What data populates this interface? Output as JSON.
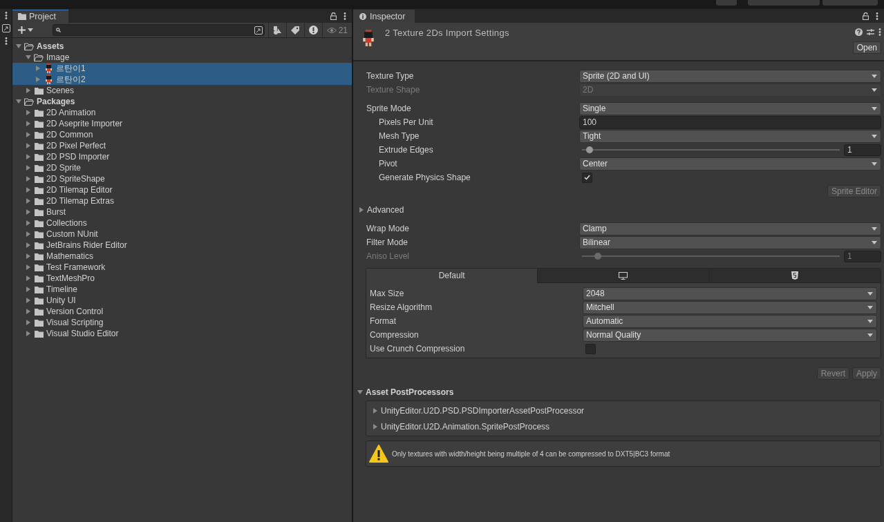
{
  "project": {
    "tab": "Project",
    "hidden_count": "21",
    "tree": [
      {
        "label": "Assets",
        "kind": "folder",
        "expanded": true,
        "selected": false,
        "children": [
          {
            "label": "Image",
            "kind": "folder",
            "expanded": true,
            "selected": false,
            "children": [
              {
                "label": "르탄이1",
                "kind": "sprite",
                "expanded": false,
                "selected": true
              },
              {
                "label": "르탄이2",
                "kind": "sprite",
                "expanded": false,
                "selected": true
              }
            ]
          },
          {
            "label": "Scenes",
            "kind": "folder",
            "expanded": false,
            "selected": false
          }
        ]
      },
      {
        "label": "Packages",
        "kind": "folder",
        "expanded": true,
        "selected": false,
        "children": [
          {
            "label": "2D Animation",
            "kind": "folder",
            "expanded": false,
            "selected": false
          },
          {
            "label": "2D Aseprite Importer",
            "kind": "folder",
            "expanded": false,
            "selected": false
          },
          {
            "label": "2D Common",
            "kind": "folder",
            "expanded": false,
            "selected": false
          },
          {
            "label": "2D Pixel Perfect",
            "kind": "folder",
            "expanded": false,
            "selected": false
          },
          {
            "label": "2D PSD Importer",
            "kind": "folder",
            "expanded": false,
            "selected": false
          },
          {
            "label": "2D Sprite",
            "kind": "folder",
            "expanded": false,
            "selected": false
          },
          {
            "label": "2D SpriteShape",
            "kind": "folder",
            "expanded": false,
            "selected": false
          },
          {
            "label": "2D Tilemap Editor",
            "kind": "folder",
            "expanded": false,
            "selected": false
          },
          {
            "label": "2D Tilemap Extras",
            "kind": "folder",
            "expanded": false,
            "selected": false
          },
          {
            "label": "Burst",
            "kind": "folder",
            "expanded": false,
            "selected": false
          },
          {
            "label": "Collections",
            "kind": "folder",
            "expanded": false,
            "selected": false
          },
          {
            "label": "Custom NUnit",
            "kind": "folder",
            "expanded": false,
            "selected": false
          },
          {
            "label": "JetBrains Rider Editor",
            "kind": "folder",
            "expanded": false,
            "selected": false
          },
          {
            "label": "Mathematics",
            "kind": "folder",
            "expanded": false,
            "selected": false
          },
          {
            "label": "Test Framework",
            "kind": "folder",
            "expanded": false,
            "selected": false
          },
          {
            "label": "TextMeshPro",
            "kind": "folder",
            "expanded": false,
            "selected": false
          },
          {
            "label": "Timeline",
            "kind": "folder",
            "expanded": false,
            "selected": false
          },
          {
            "label": "Unity UI",
            "kind": "folder",
            "expanded": false,
            "selected": false
          },
          {
            "label": "Version Control",
            "kind": "folder",
            "expanded": false,
            "selected": false
          },
          {
            "label": "Visual Scripting",
            "kind": "folder",
            "expanded": false,
            "selected": false
          },
          {
            "label": "Visual Studio Editor",
            "kind": "folder",
            "expanded": false,
            "selected": false
          }
        ]
      }
    ]
  },
  "inspector": {
    "tab": "Inspector",
    "title": "2 Texture 2Ds Import Settings",
    "open_button": "Open",
    "sections": [
      {
        "fields": [
          {
            "kind": "dropdown",
            "label": "Texture Type",
            "value": "Sprite (2D and UI)",
            "disabled": false
          },
          {
            "kind": "dropdown",
            "label": "Texture Shape",
            "value": "2D",
            "disabled": true
          }
        ]
      },
      {
        "fields": [
          {
            "kind": "dropdown",
            "label": "Sprite Mode",
            "value": "Single",
            "disabled": false,
            "children": [
              {
                "kind": "number",
                "label": "Pixels Per Unit",
                "value": "100",
                "disabled": false
              },
              {
                "kind": "dropdown",
                "label": "Mesh Type",
                "value": "Tight",
                "disabled": false
              },
              {
                "kind": "slider",
                "label": "Extrude Edges",
                "value": "1",
                "level": 0.03,
                "disabled": false
              },
              {
                "kind": "dropdown",
                "label": "Pivot",
                "value": "Center",
                "disabled": false
              },
              {
                "kind": "checkbox",
                "label": "Generate Physics Shape",
                "checked": true,
                "disabled": false
              }
            ]
          },
          {
            "kind": "button",
            "label": "Sprite Editor",
            "disabled": true
          }
        ]
      },
      {
        "fields": [
          {
            "kind": "foldout",
            "label": "Advanced",
            "expanded": false
          }
        ]
      },
      {
        "fields": [
          {
            "kind": "dropdown",
            "label": "Wrap Mode",
            "value": "Clamp",
            "disabled": false
          },
          {
            "kind": "dropdown",
            "label": "Filter Mode",
            "value": "Bilinear",
            "disabled": false
          },
          {
            "kind": "slider",
            "label": "Aniso Level",
            "value": "1",
            "level": 0.0625,
            "disabled": true
          }
        ]
      }
    ],
    "platform": {
      "tabs": [
        {
          "kind": "text",
          "label": "Default",
          "selected": true
        },
        {
          "kind": "desktop",
          "selected": false
        },
        {
          "kind": "html5",
          "selected": false
        }
      ],
      "fields": [
        {
          "kind": "dropdown",
          "label": "Max Size",
          "value": "2048",
          "disabled": false
        },
        {
          "kind": "dropdown",
          "label": "Resize Algorithm",
          "value": "Mitchell",
          "disabled": false
        },
        {
          "kind": "dropdown",
          "label": "Format",
          "value": "Automatic",
          "disabled": false
        },
        {
          "kind": "dropdown",
          "label": "Compression",
          "value": "Normal Quality",
          "disabled": false
        },
        {
          "kind": "checkbox",
          "label": "Use Crunch Compression",
          "checked": false,
          "disabled": false
        }
      ]
    },
    "buttons": [
      {
        "label": "Revert",
        "disabled": true
      },
      {
        "label": "Apply",
        "disabled": true
      }
    ],
    "post_processors": {
      "title": "Asset PostProcessors",
      "expanded": true,
      "items": [
        {
          "label": "UnityEditor.U2D.PSD.PSDImporterAssetPostProcessor",
          "expanded": false
        },
        {
          "label": "UnityEditor.U2D.Animation.SpritePostProcess",
          "expanded": false
        }
      ]
    },
    "warning": "Only textures with width/height being multiple of 4 can be compressed to DXT5|BC3 format"
  }
}
